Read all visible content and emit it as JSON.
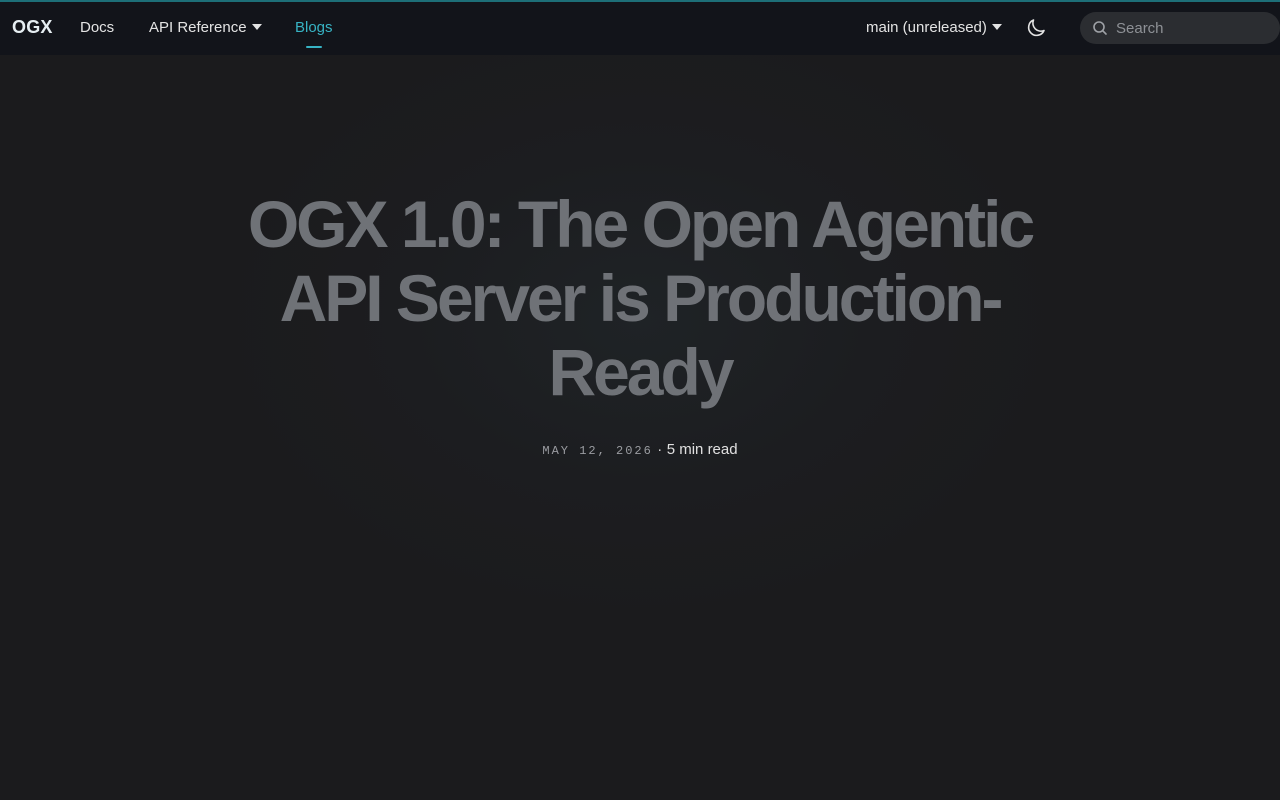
{
  "navbar": {
    "brand": "OGX",
    "items": [
      {
        "label": "Docs"
      },
      {
        "label": "API Reference"
      },
      {
        "label": "Blogs"
      }
    ],
    "version_label": "main (unreleased)",
    "theme_toggle_icon": "moon-icon",
    "search": {
      "placeholder": "Search",
      "value": "",
      "icon": "search-icon"
    }
  },
  "hero": {
    "title": "OGX 1.0: The Open Agentic API Server is Production-Ready",
    "date": "MAY 12, 2026",
    "separator": "·",
    "read_time": "5 min read"
  },
  "colors": {
    "accent": "#37b3c4",
    "navbar_bg": "#12141a",
    "page_bg": "#1b1b1d",
    "title_color": "#6f7277"
  }
}
